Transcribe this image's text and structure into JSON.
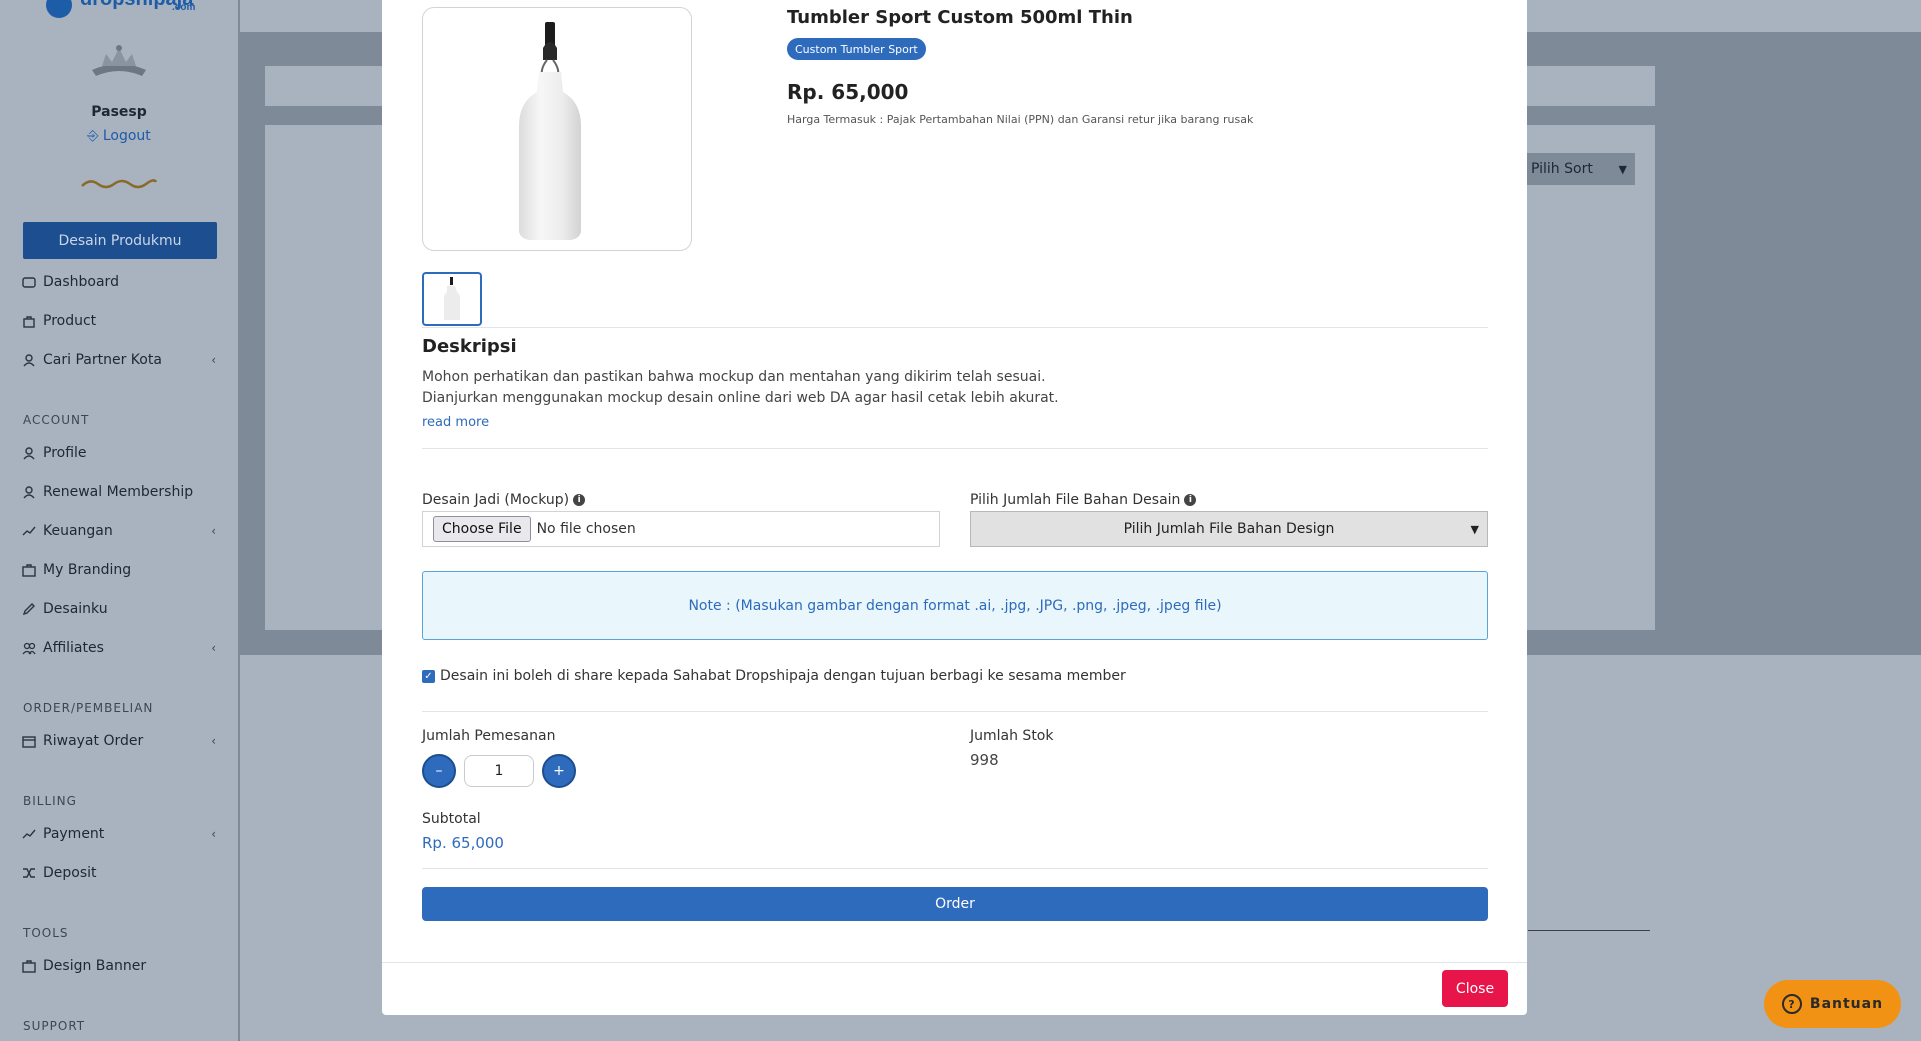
{
  "sidebar": {
    "brand": "dropshipaja",
    "brand_sub": ".com",
    "user_name": "Pasesp",
    "logout_label": "Logout",
    "design_button": "Desain Produkmu",
    "items_main": [
      {
        "label": "Dashboard",
        "icon": "dashboard-icon"
      },
      {
        "label": "Product",
        "icon": "bag-icon"
      },
      {
        "label": "Cari Partner Kota",
        "icon": "user-search-icon",
        "has_children": true
      }
    ],
    "section_account": "ACCOUNT",
    "items_account": [
      {
        "label": "Profile",
        "icon": "user-icon"
      },
      {
        "label": "Renewal Membership",
        "icon": "user-icon"
      },
      {
        "label": "Keuangan",
        "icon": "trend-icon",
        "has_children": true
      },
      {
        "label": "My Branding",
        "icon": "briefcase-icon"
      },
      {
        "label": "Desainku",
        "icon": "pencil-icon"
      },
      {
        "label": "Affiliates",
        "icon": "people-icon",
        "has_children": true
      }
    ],
    "section_order": "ORDER/PEMBELIAN",
    "items_order": [
      {
        "label": "Riwayat Order",
        "icon": "calendar-icon",
        "has_children": true
      }
    ],
    "section_billing": "BILLING",
    "items_billing": [
      {
        "label": "Payment",
        "icon": "trend-icon",
        "has_children": true
      },
      {
        "label": "Deposit",
        "icon": "shuffle-icon"
      }
    ],
    "section_tools": "TOOLS",
    "items_tools": [
      {
        "label": "Design Banner",
        "icon": "briefcase-icon"
      }
    ],
    "section_support": "SUPPORT"
  },
  "background": {
    "sort_select": "Pilih Sort"
  },
  "product": {
    "title": "Tumbler Sport Custom 500ml Thin",
    "category": "Custom Tumbler Sport",
    "price": "Rp. 65,000",
    "price_note": "Harga Termasuk : Pajak Pertambahan Nilai (PPN) dan Garansi retur jika barang rusak"
  },
  "description": {
    "title": "Deskripsi",
    "lines": [
      "Mohon perhatikan dan pastikan bahwa mockup dan mentahan yang dikirim telah sesuai.",
      "Dianjurkan menggunakan mockup desain online dari web DA agar hasil cetak lebih akurat."
    ],
    "read_more": "read more"
  },
  "form": {
    "mockup_label": "Desain Jadi (Mockup)",
    "file_button": "Choose File",
    "file_status": "No file chosen",
    "file_count_label": "Pilih Jumlah File Bahan Desain",
    "file_count_selected": "Pilih Jumlah File Bahan Design",
    "note": "Note : (Masukan gambar dengan format .ai, .jpg, .JPG, .png, .jpeg, .jpeg file)",
    "share_label": "Desain ini boleh di share kepada Sahabat Dropshipaja dengan tujuan berbagi ke sesama member",
    "share_checked": true,
    "qty_label": "Jumlah Pemesanan",
    "qty_minus": "–",
    "qty_value": "1",
    "qty_plus": "+",
    "stock_label": "Jumlah Stok",
    "stock_value": "998",
    "subtotal_label": "Subtotal",
    "subtotal_value": "Rp. 65,000",
    "order_button": "Order"
  },
  "modal": {
    "close_button": "Close"
  },
  "help": {
    "label": "Bantuan"
  },
  "colors": {
    "primary": "#2e6bbd",
    "danger": "#e8154b",
    "help": "#f19215"
  }
}
